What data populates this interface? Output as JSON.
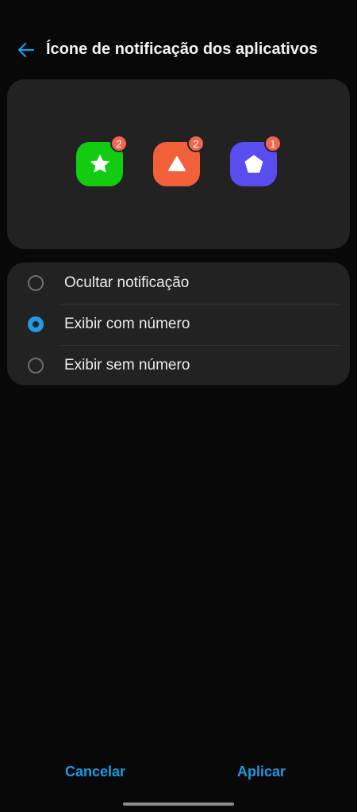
{
  "header": {
    "back_icon": "arrow-left-icon",
    "title": "Ícone de notificação dos aplicativos"
  },
  "preview": {
    "apps": [
      {
        "icon": "star-icon",
        "color": "#12cc12",
        "badge": "2"
      },
      {
        "icon": "triangle-icon",
        "color": "#f2603a",
        "badge": "2"
      },
      {
        "icon": "pentagon-icon",
        "color": "#5a4df0",
        "badge": "1"
      }
    ]
  },
  "options": [
    {
      "label": "Ocultar notificação",
      "selected": false
    },
    {
      "label": "Exibir com número",
      "selected": true
    },
    {
      "label": "Exibir sem número",
      "selected": false
    }
  ],
  "footer": {
    "cancel_label": "Cancelar",
    "apply_label": "Aplicar"
  },
  "colors": {
    "accent": "#1f9ae6",
    "badge": "#f2654f",
    "card": "#222222",
    "background": "#080808"
  }
}
